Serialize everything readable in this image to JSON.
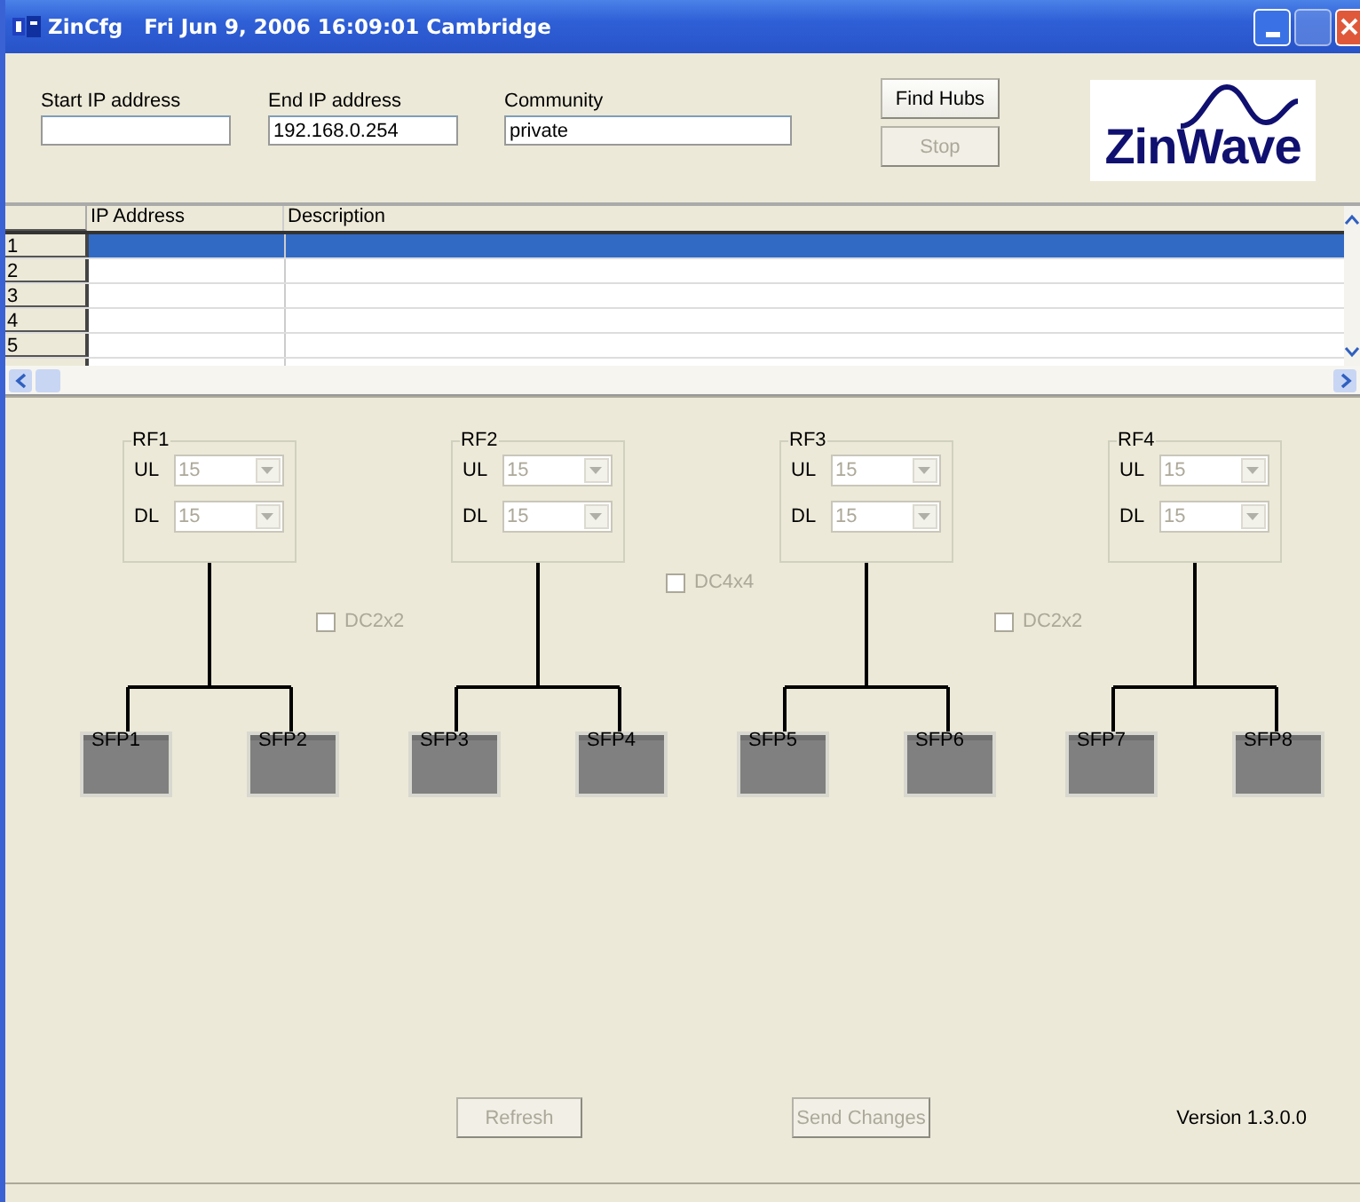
{
  "window": {
    "title": "ZinCfg   Fri Jun 9, 2006 16:09:01 Cambridge",
    "maximize_disabled": true
  },
  "fields": [
    {
      "label": "Start IP address"
    },
    {
      "label": "End IP address",
      "value": "192.168.0.254"
    },
    {
      "label": "Community",
      "value": "private"
    }
  ],
  "top_buttons": [
    {
      "label": "Find Hubs",
      "disabled": false
    },
    {
      "label": "Stop",
      "disabled": true
    }
  ],
  "logo": {
    "text": "ZinWave"
  },
  "table": {
    "columns": [
      "IP Address",
      "Description"
    ],
    "rows": [
      {
        "number": "1",
        "selected": true
      },
      {
        "number": "2",
        "selected": false
      },
      {
        "number": "3",
        "selected": false
      },
      {
        "number": "4",
        "selected": false
      },
      {
        "number": "5",
        "selected": false
      }
    ]
  },
  "rf_groups": [
    {
      "label": "RF1",
      "ul": "15",
      "dl": "15",
      "ul_label": "UL",
      "dl_label": "DL",
      "sfps": [
        "SFP1",
        "SFP2"
      ]
    },
    {
      "label": "RF2",
      "ul": "15",
      "dl": "15",
      "ul_label": "UL",
      "dl_label": "DL",
      "sfps": [
        "SFP3",
        "SFP4"
      ]
    },
    {
      "label": "RF3",
      "ul": "15",
      "dl": "15",
      "ul_label": "UL",
      "dl_label": "DL",
      "sfps": [
        "SFP5",
        "SFP6"
      ]
    },
    {
      "label": "RF4",
      "ul": "15",
      "dl": "15",
      "ul_label": "UL",
      "dl_label": "DL",
      "sfps": [
        "SFP7",
        "SFP8"
      ]
    }
  ],
  "combine_checkboxes": [
    {
      "label": "DC2x2",
      "checked": false,
      "disabled": true
    },
    {
      "label": "DC4x4",
      "checked": false,
      "disabled": true
    },
    {
      "label": "DC2x2",
      "checked": false,
      "disabled": true
    }
  ],
  "bottom_buttons": [
    {
      "label": "Refresh",
      "disabled": true
    },
    {
      "label": "Send Changes",
      "disabled": true
    }
  ],
  "version": "Version 1.3.0.0"
}
